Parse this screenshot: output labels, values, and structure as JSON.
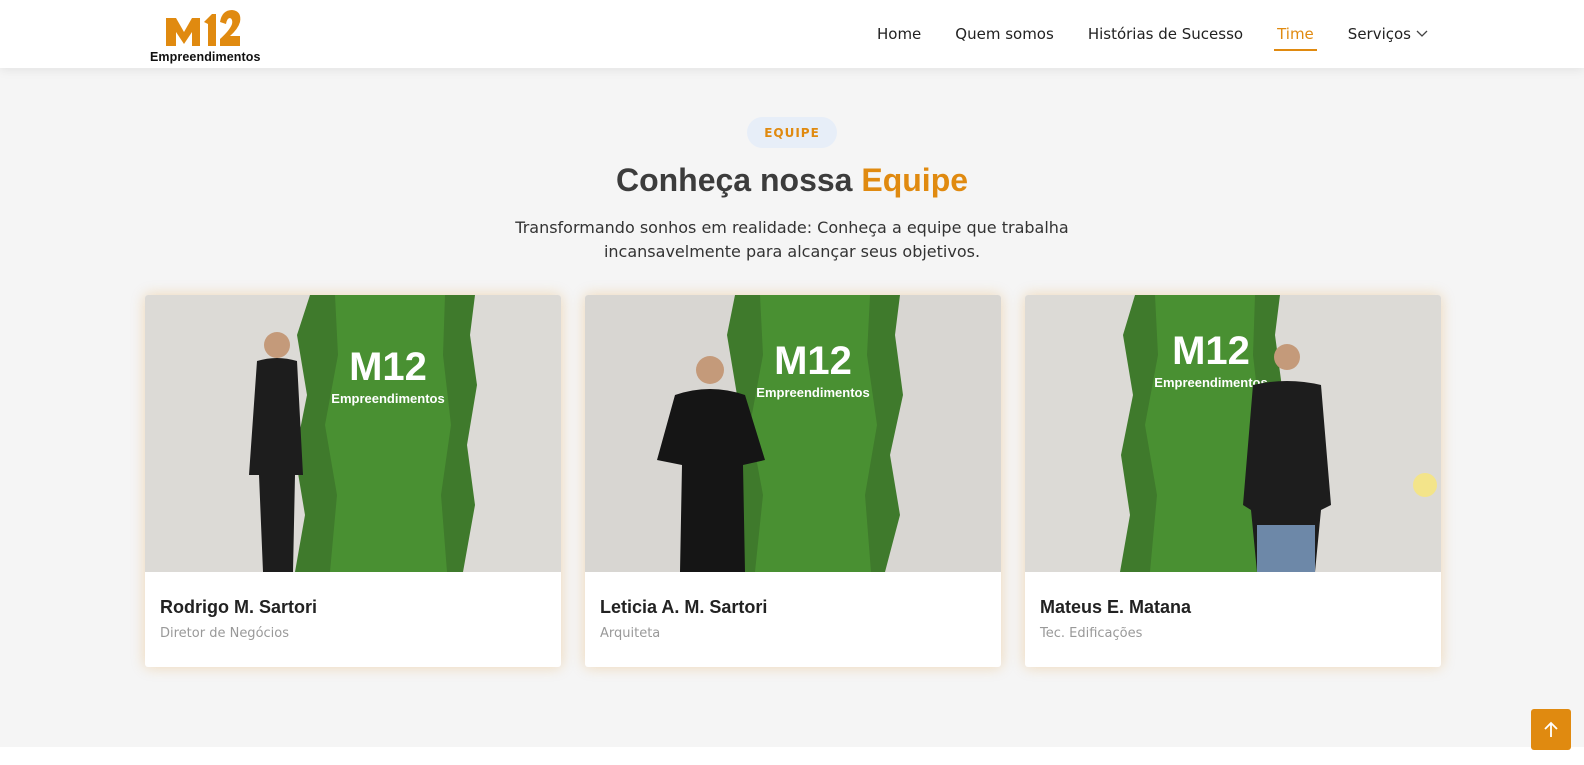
{
  "brand": {
    "logo_mark_text": "M12",
    "logo_subtext": "Empreendimentos",
    "accent_color": "#e08a10"
  },
  "nav": {
    "items": [
      {
        "label": "Home",
        "active": false
      },
      {
        "label": "Quem somos",
        "active": false
      },
      {
        "label": "Histórias de Sucesso",
        "active": false
      },
      {
        "label": "Time",
        "active": true
      },
      {
        "label": "Serviços",
        "active": false,
        "icon": "chevron-down-icon"
      }
    ]
  },
  "section": {
    "badge": "EQUIPE",
    "title_prefix": "Conheça nossa",
    "title_accent": "Equipe",
    "subtitle": "Transformando sonhos em realidade: Conheça a equipe que trabalha incansavelmente para alcançar seus objetivos."
  },
  "team": [
    {
      "name": "Rodrigo M. Sartori",
      "role": "Diretor de Negócios",
      "photo_sign": "Empreendimentos"
    },
    {
      "name": "Leticia A. M. Sartori",
      "role": "Arquiteta",
      "photo_sign": "Empreendimentos"
    },
    {
      "name": "Mateus E. Matana",
      "role": "Tec. Edificações",
      "photo_sign": "Empreendimentos"
    }
  ],
  "scroll_top": {
    "icon": "arrow-up-icon"
  }
}
